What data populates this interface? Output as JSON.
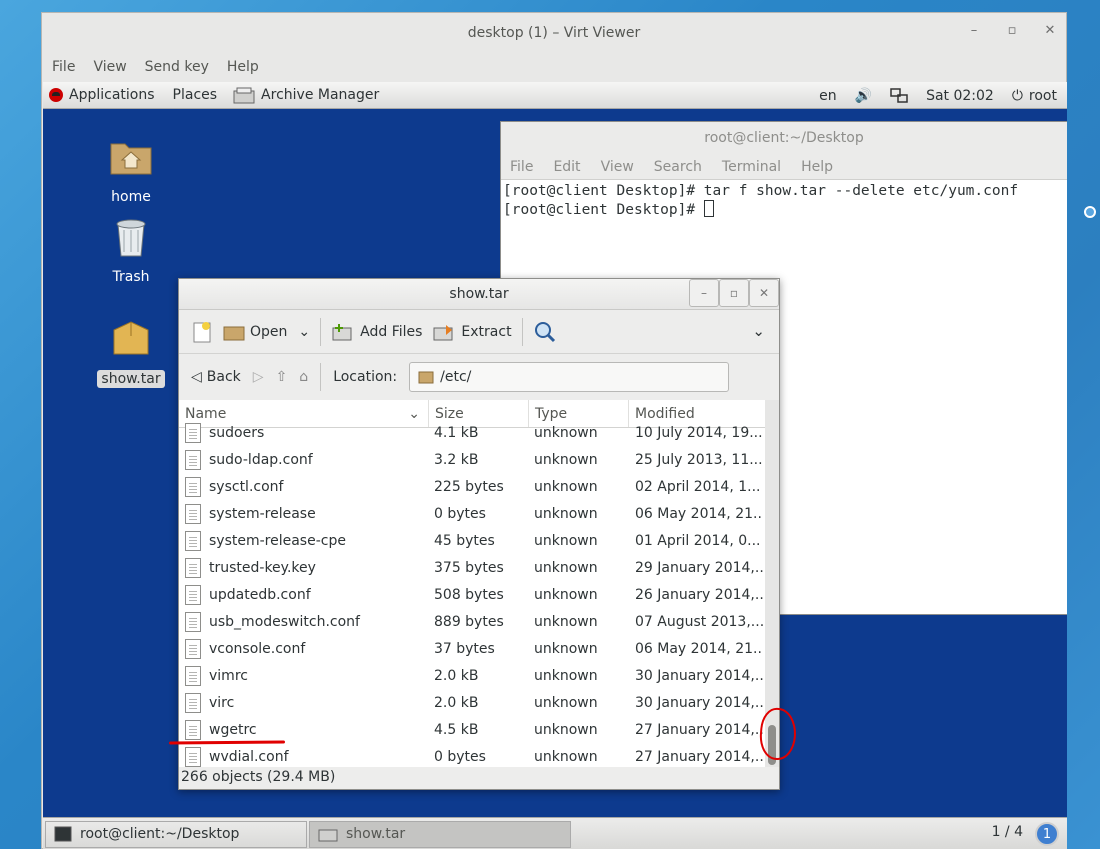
{
  "viewer": {
    "title": "desktop (1) – Virt Viewer",
    "menu": [
      "File",
      "View",
      "Send key",
      "Help"
    ]
  },
  "topbar": {
    "applications": "Applications",
    "places": "Places",
    "active_app": "Archive Manager",
    "lang": "en",
    "clock": "Sat 02:02",
    "user": "root"
  },
  "desktop": {
    "icons": [
      {
        "label": "home"
      },
      {
        "label": "Trash"
      },
      {
        "label": "show.tar"
      }
    ]
  },
  "terminal": {
    "title": "root@client:~/Desktop",
    "menu": [
      "File",
      "Edit",
      "View",
      "Search",
      "Terminal",
      "Help"
    ],
    "lines": [
      "[root@client Desktop]# tar f show.tar --delete etc/yum.conf",
      "[root@client Desktop]# "
    ]
  },
  "archive": {
    "title": "show.tar",
    "toolbar": {
      "open": "Open",
      "add_files": "Add Files",
      "extract": "Extract"
    },
    "nav": {
      "back": "Back",
      "location_label": "Location:",
      "location_value": "/etc/"
    },
    "columns": [
      "Name",
      "Size",
      "Type",
      "Modified"
    ],
    "rows": [
      {
        "name": "sudoers",
        "size": "4.1 kB",
        "type": "unknown",
        "modified": "10 July 2014, 19..."
      },
      {
        "name": "sudo-ldap.conf",
        "size": "3.2 kB",
        "type": "unknown",
        "modified": "25 July 2013, 11..."
      },
      {
        "name": "sysctl.conf",
        "size": "225 bytes",
        "type": "unknown",
        "modified": "02 April 2014, 1..."
      },
      {
        "name": "system-release",
        "size": "0 bytes",
        "type": "unknown",
        "modified": "06 May 2014, 21..."
      },
      {
        "name": "system-release-cpe",
        "size": "45 bytes",
        "type": "unknown",
        "modified": "01 April 2014, 0..."
      },
      {
        "name": "trusted-key.key",
        "size": "375 bytes",
        "type": "unknown",
        "modified": "29 January 2014,..."
      },
      {
        "name": "updatedb.conf",
        "size": "508 bytes",
        "type": "unknown",
        "modified": "26 January 2014,..."
      },
      {
        "name": "usb_modeswitch.conf",
        "size": "889 bytes",
        "type": "unknown",
        "modified": "07 August 2013,..."
      },
      {
        "name": "vconsole.conf",
        "size": "37 bytes",
        "type": "unknown",
        "modified": "06 May 2014, 21..."
      },
      {
        "name": "vimrc",
        "size": "2.0 kB",
        "type": "unknown",
        "modified": "30 January 2014,..."
      },
      {
        "name": "virc",
        "size": "2.0 kB",
        "type": "unknown",
        "modified": "30 January 2014,..."
      },
      {
        "name": "wgetrc",
        "size": "4.5 kB",
        "type": "unknown",
        "modified": "27 January 2014,..."
      },
      {
        "name": "wvdial.conf",
        "size": "0 bytes",
        "type": "unknown",
        "modified": "27 January 2014,..."
      }
    ],
    "status": "266 objects (29.4 MB)"
  },
  "taskbar": {
    "tasks": [
      "root@client:~/Desktop",
      "show.tar"
    ],
    "workspace": "1 / 4",
    "workspace_badge": "1"
  }
}
